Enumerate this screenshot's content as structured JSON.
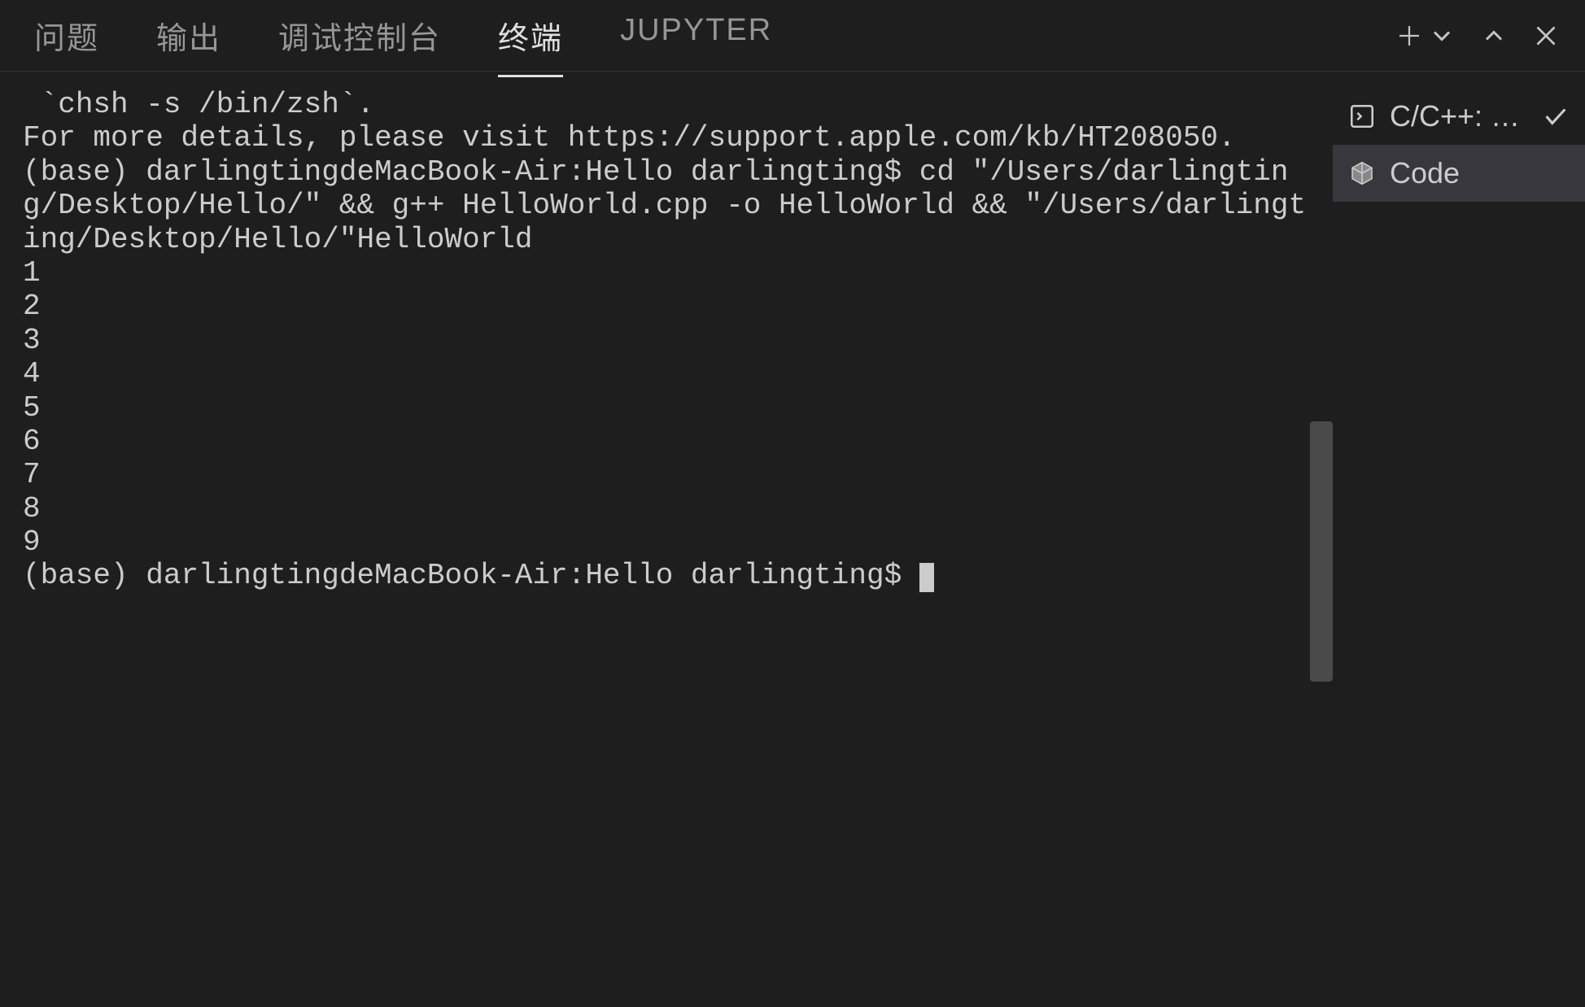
{
  "tabs": {
    "problems": "问题",
    "output": "输出",
    "debug_console": "调试控制台",
    "terminal": "终端",
    "jupyter": "JUPYTER"
  },
  "terminal": {
    "lines": [
      " `chsh -s /bin/zsh`.",
      "For more details, please visit https://support.apple.com/kb/HT208050.",
      "(base) darlingtingdeMacBook-Air:Hello darlingting$ cd \"/Users/darlingting/Desktop/Hello/\" && g++ HelloWorld.cpp -o HelloWorld && \"/Users/darlingting/Desktop/Hello/\"HelloWorld",
      "1",
      "2",
      "3",
      "4",
      "5",
      "6",
      "7",
      "8",
      "9",
      "(base) darlingtingdeMacBook-Air:Hello darlingting$ "
    ]
  },
  "sidebar": {
    "task": {
      "label": "C/C++: …"
    },
    "code": {
      "label": "Code"
    }
  }
}
